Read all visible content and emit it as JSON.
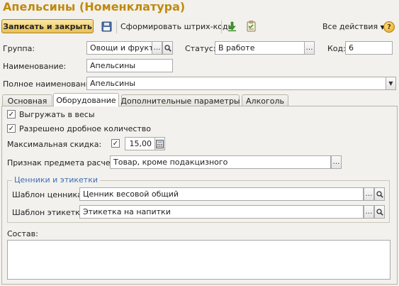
{
  "window": {
    "title": "Апельсины (Номенклатура)"
  },
  "toolbar": {
    "save_close_label": "Записать и закрыть",
    "barcode_label": "Сформировать штрих-коды",
    "all_actions_label": "Все действия",
    "help_label": "?"
  },
  "header": {
    "group_label": "Группа:",
    "group_value": "Овощи и фрукты",
    "status_label": "Статус:",
    "status_value": "В работе",
    "code_label": "Код:",
    "code_value": "6",
    "name_label": "Наименование:",
    "name_value": "Апельсины",
    "full_name_label": "Полное наименование:",
    "full_name_value": "Апельсины"
  },
  "tabs": [
    {
      "label": "Основная"
    },
    {
      "label": "Оборудование",
      "active": true
    },
    {
      "label": "Дополнительные параметры"
    },
    {
      "label": "Алкоголь"
    }
  ],
  "equipment": {
    "upload_scales_label": "Выгружать в весы",
    "upload_scales_checked": true,
    "fractional_label": "Разрешено дробное количество",
    "fractional_checked": true,
    "max_discount_label": "Максимальная скидка:",
    "max_discount_checked": true,
    "max_discount_value": "15,00",
    "payment_subject_label": "Признак предмета расчета:",
    "payment_subject_value": "Товар, кроме подакцизного",
    "price_tags_group_title": "Ценники и этикетки",
    "price_tag_template_label": "Шаблон ценника:",
    "price_tag_template_value": "Ценник весовой общий",
    "label_template_label": "Шаблон этикетки:",
    "label_template_value": "Этикетка на напитки",
    "composition_label": "Состав:",
    "composition_value": ""
  },
  "colors": {
    "title": "#c08a0e",
    "group_title": "#3d6fb4",
    "primary_button": "#e9c055"
  }
}
